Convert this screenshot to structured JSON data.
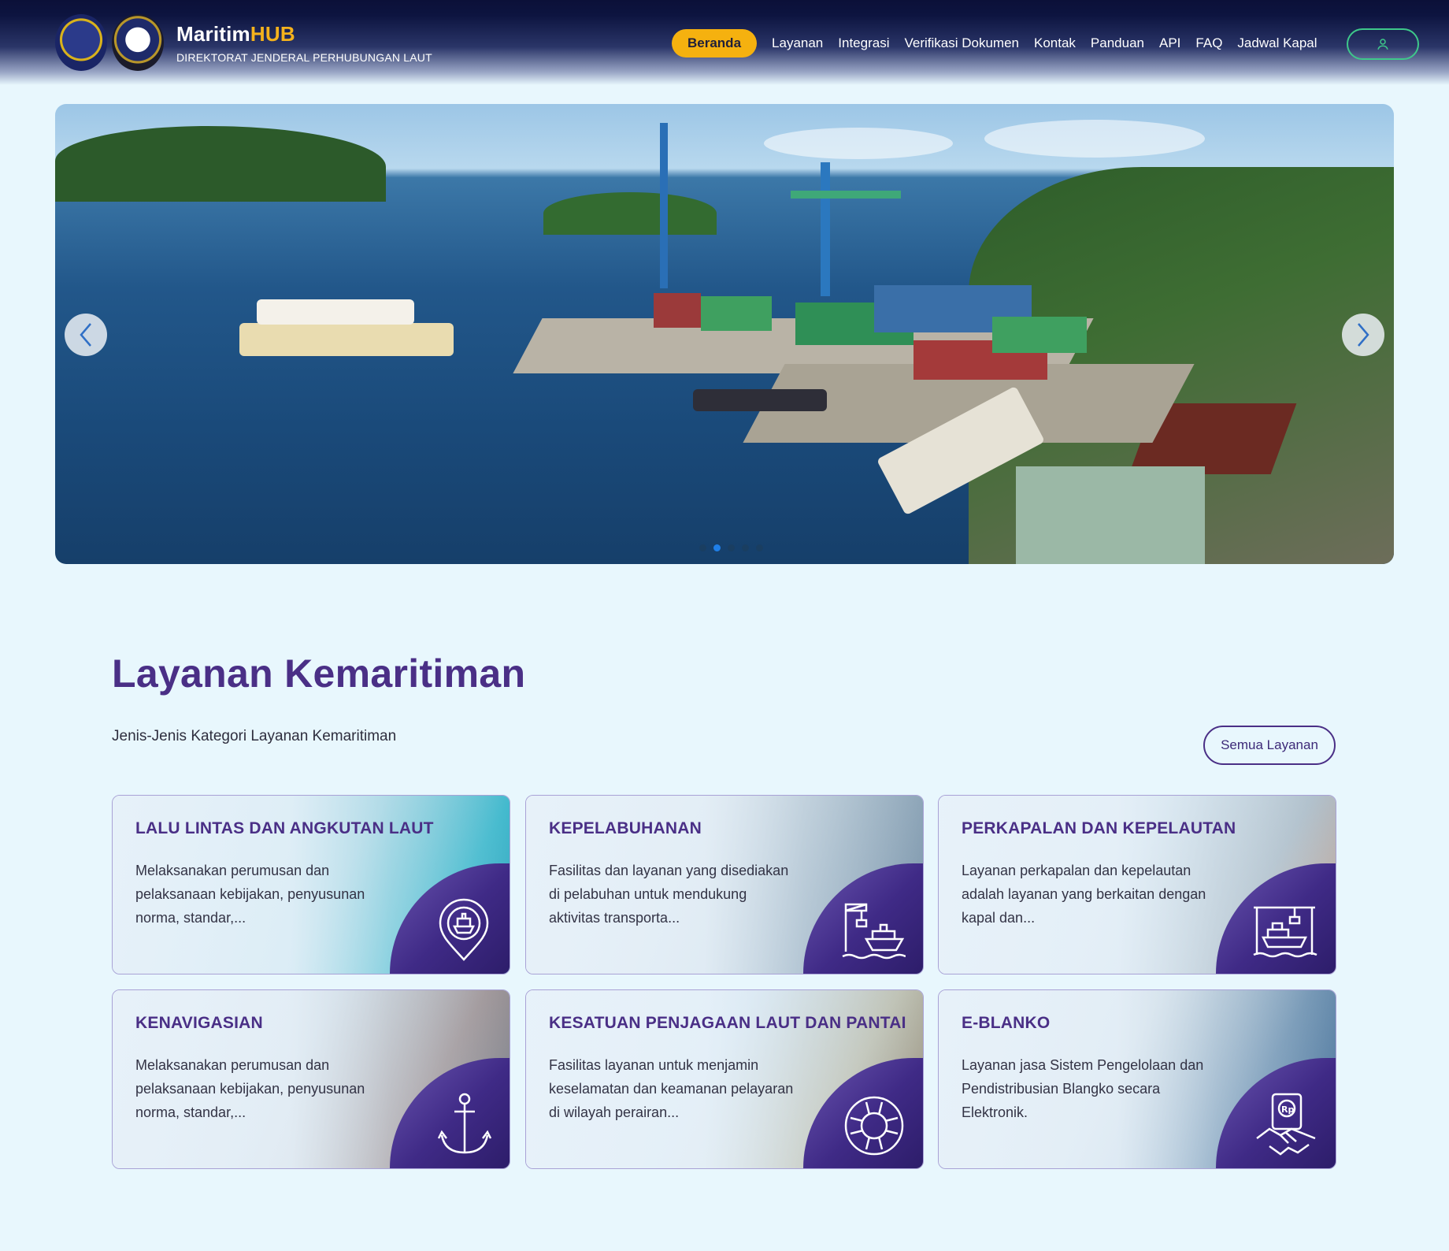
{
  "header": {
    "brand_name_main": "Maritim",
    "brand_name_accent": "HUB",
    "brand_subtitle": "DIREKTORAT JENDERAL PERHUBUNGAN LAUT",
    "nav": [
      {
        "label": "Beranda",
        "active": true
      },
      {
        "label": "Layanan"
      },
      {
        "label": "Integrasi"
      },
      {
        "label": "Verifikasi Dokumen"
      },
      {
        "label": "Kontak"
      },
      {
        "label": "Panduan"
      },
      {
        "label": "API"
      },
      {
        "label": "FAQ"
      },
      {
        "label": "Jadwal Kapal"
      }
    ],
    "user_icon": "user-icon"
  },
  "hero": {
    "prev_icon": "chevron-left-icon",
    "next_icon": "chevron-right-icon",
    "slides_count": 5,
    "active_slide": 2
  },
  "section": {
    "title": "Layanan Kemaritiman",
    "subtitle": "Jenis-Jenis Kategori Layanan Kemaritiman",
    "all_button": "Semua Layanan"
  },
  "cards": [
    {
      "title": "LALU LINTAS DAN ANGKUTAN LAUT",
      "desc": "Melaksanakan perumusan dan pelaksanaan kebijakan, penyusunan norma, standar,...",
      "icon": "ship-location-icon"
    },
    {
      "title": "KEPELABUHANAN",
      "desc": "Fasilitas dan layanan yang disediakan di pelabuhan untuk mendukung aktivitas transporta...",
      "icon": "port-crane-ship-icon"
    },
    {
      "title": "PERKAPALAN DAN KEPELAUTAN",
      "desc": "Layanan perkapalan dan kepelautan adalah layanan yang berkaitan dengan kapal dan...",
      "icon": "shipyard-icon"
    },
    {
      "title": "KENAVIGASIAN",
      "desc": "Melaksanakan perumusan dan pelaksanaan kebijakan, penyusunan norma, standar,...",
      "icon": "anchor-icon"
    },
    {
      "title": "KESATUAN PENJAGAAN LAUT DAN PANTAI",
      "desc": "Fasilitas layanan untuk menjamin keselamatan dan keamanan pelayaran di wilayah perairan...",
      "icon": "lifebuoy-icon"
    },
    {
      "title": "E-BLANKO",
      "desc": "Layanan jasa Sistem Pengelolaan dan Pendistribusian Blangko secara Elektronik.",
      "icon": "handshake-payment-icon"
    }
  ],
  "colors": {
    "accent": "#f5b10f",
    "primary": "#4a2f86",
    "page_bg": "#e8f7fd",
    "header_bg": "#0b1038",
    "user_border": "#3ec88a"
  }
}
